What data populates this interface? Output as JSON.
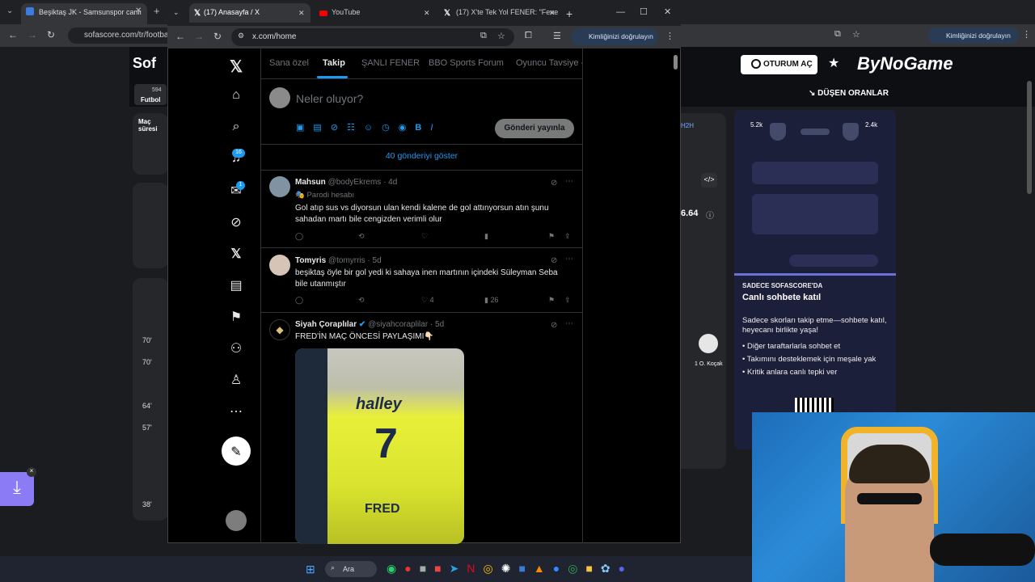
{
  "bg_browser": {
    "tab_title": "Beşiktaş JK - Samsunspor canlı",
    "url": "sofascore.com/tr/football",
    "verify_label": "Kimliğinizi doğrulayın"
  },
  "sofascore": {
    "logo": "Sof",
    "sport_count": "594",
    "sport_label": "Futbol",
    "match_label": "Maç süresi",
    "login_label": "OTURUM AÇ",
    "partner": "ByNoGame",
    "odds_label": "DÜŞEN ORANLAR",
    "h2h": "H2H",
    "stat_left": "5.2k",
    "stat_right": "2.4k",
    "rating": "6.64",
    "player": "O. Koçak",
    "player_num": "1",
    "chat_kicker": "SADECE SOFASCORE'DA",
    "chat_title": "Canlı sohbete katıl",
    "chat_desc": "Sadece skorları takip etme—sohbete katıl, heyecanı birlikte yaşa!",
    "chat_bullets": [
      "Diğer taraftarlarla sohbet et",
      "Takımını desteklemek için meşale yak",
      "Kritik anlara canlı tepki ver"
    ],
    "minutes": [
      "70'",
      "70'",
      "64'",
      "57'",
      "38'"
    ]
  },
  "tabs": [
    {
      "label": "(17) Anasayfa / X"
    },
    {
      "label": "YouTube"
    },
    {
      "label": "(17) X'te Tek Yol FENER: \"Fene"
    }
  ],
  "address": {
    "url": "x.com/home",
    "verify_label": "Kimliğinizi doğrulayın"
  },
  "x_nav": {
    "notif_badge": "16",
    "msg_badge": "1"
  },
  "feed_tabs": [
    "Sana özel",
    "Takip",
    "ŞANLI FENER",
    "BBO Sports Forum",
    "Oyuncu Tavsiye -"
  ],
  "compose": {
    "placeholder": "Neler oluyor?",
    "post_label": "Gönderi yayınla"
  },
  "show_more": "40 gönderiyi göster",
  "tweets": [
    {
      "name": "Mahsun",
      "handle": "@bodyEkrems · 4d",
      "sub": "Parodi hesabı",
      "text": "Gol atıp sus vs diyorsun ulan kendi kalene de gol attınyorsun atın şunu sahadan martı bile cengizden verimli olur",
      "likes": "",
      "views": ""
    },
    {
      "name": "Tomyris",
      "handle": "@tomyrris · 5d",
      "sub": "",
      "text": "beşiktaş öyle bir gol yedi ki sahaya inen martının içindeki Süleyman Seba bile utanmıştır",
      "likes": "4",
      "views": "26"
    },
    {
      "name": "Siyah Çoraplılar",
      "handle": "@siyahcoraplilar · 5d",
      "sub": "",
      "text": "FRED'İN MAÇ ÖNCESİ PAYLAŞIMI👇🏻",
      "likes": "",
      "views": ""
    }
  ],
  "jersey": {
    "sponsor": "halley",
    "number": "7",
    "name": "FRED"
  },
  "taskbar": {
    "search": "Ara"
  }
}
